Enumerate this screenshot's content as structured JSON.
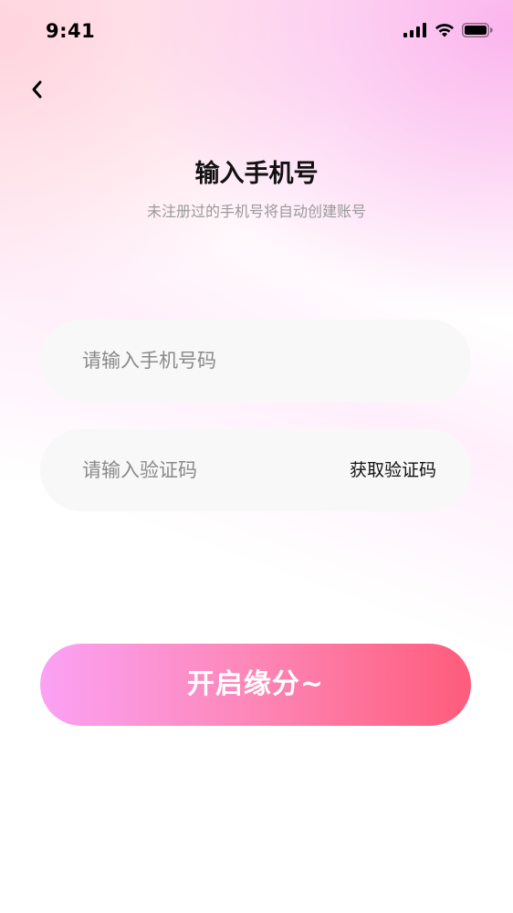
{
  "status_bar": {
    "time": "9:41",
    "icons": [
      "signal-icon",
      "wifi-icon",
      "battery-icon"
    ]
  },
  "header": {
    "back_icon": "chevron-left-icon",
    "title": "输入手机号",
    "subtitle": "未注册过的手机号将自动创建账号"
  },
  "form": {
    "phone_placeholder": "请输入手机号码",
    "phone_value": "",
    "code_placeholder": "请输入验证码",
    "code_value": "",
    "get_code_label": "获取验证码"
  },
  "submit": {
    "label": "开启缘分~"
  },
  "colors": {
    "gradient_start": "#fba2f4",
    "gradient_end": "#fe5c7b",
    "field_bg": "#f8f8f8"
  }
}
